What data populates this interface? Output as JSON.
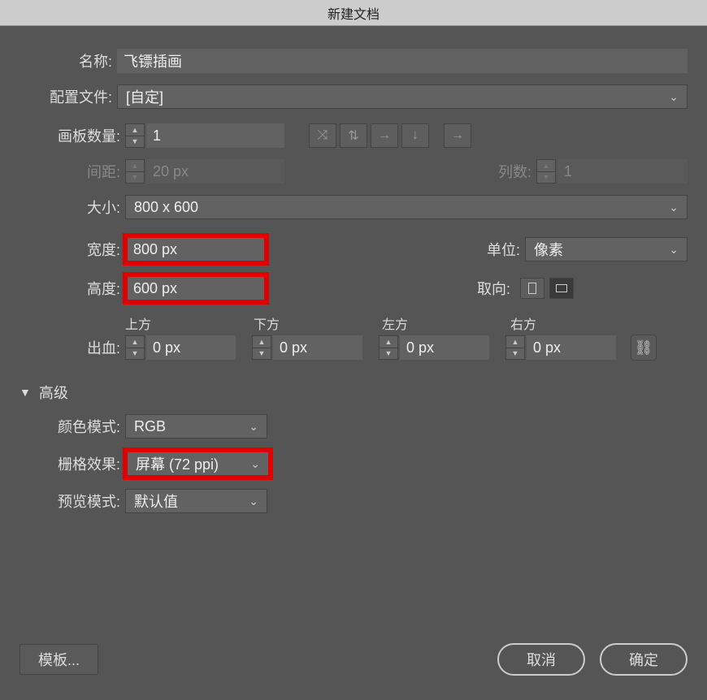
{
  "title": "新建文档",
  "name": {
    "label": "名称:",
    "value": "飞镖插画"
  },
  "profile": {
    "label": "配置文件:",
    "value": "[自定]"
  },
  "artboards": {
    "label": "画板数量:",
    "value": "1"
  },
  "spacing": {
    "label": "间距:",
    "value": "20 px"
  },
  "columns": {
    "label": "列数:",
    "value": "1"
  },
  "size": {
    "label": "大小:",
    "value": "800 x 600"
  },
  "width": {
    "label": "宽度:",
    "value": "800 px"
  },
  "height": {
    "label": "高度:",
    "value": "600 px"
  },
  "units": {
    "label": "单位:",
    "value": "像素"
  },
  "orientation": {
    "label": "取向:"
  },
  "bleed": {
    "label": "出血:",
    "top": {
      "label": "上方",
      "value": "0 px"
    },
    "bottom": {
      "label": "下方",
      "value": "0 px"
    },
    "left": {
      "label": "左方",
      "value": "0 px"
    },
    "right": {
      "label": "右方",
      "value": "0 px"
    }
  },
  "advanced": {
    "label": "高级"
  },
  "colorMode": {
    "label": "颜色模式:",
    "value": "RGB"
  },
  "rasterEffects": {
    "label": "栅格效果:",
    "value": "屏幕 (72 ppi)"
  },
  "previewMode": {
    "label": "预览模式:",
    "value": "默认值"
  },
  "buttons": {
    "templates": "模板...",
    "cancel": "取消",
    "ok": "确定"
  }
}
